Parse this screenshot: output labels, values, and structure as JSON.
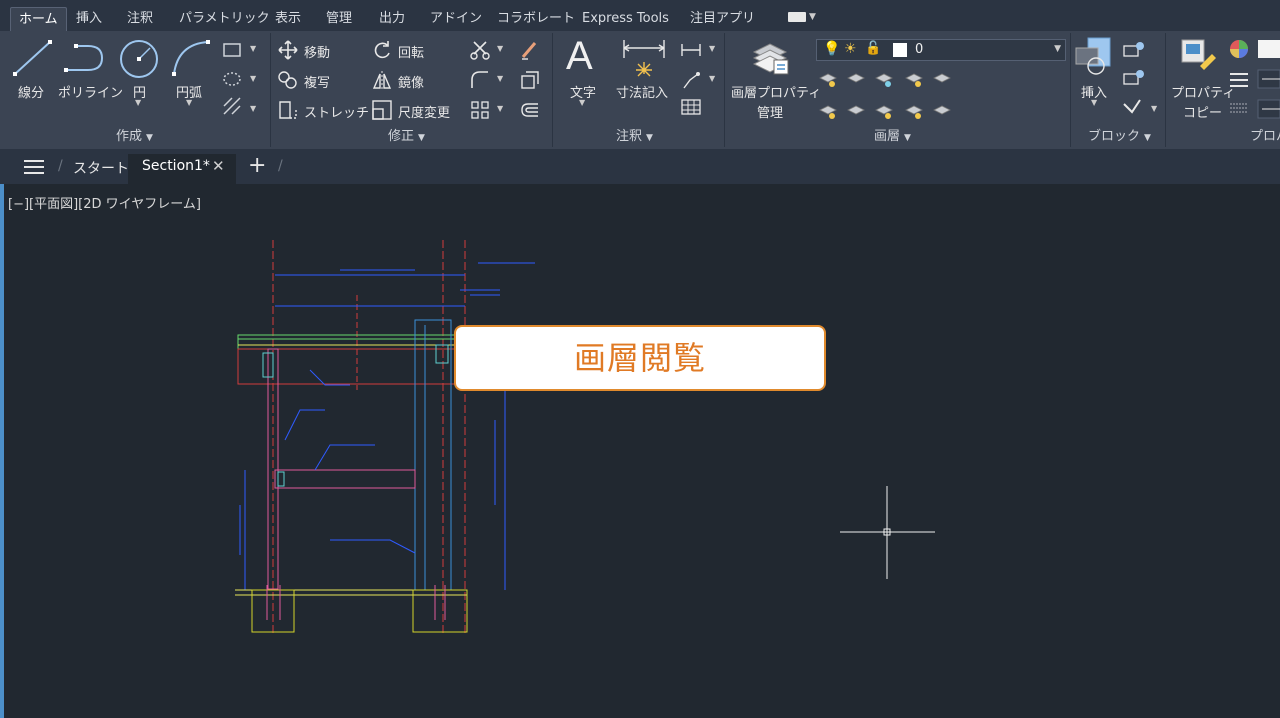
{
  "menu_tabs": [
    "ホーム",
    "挿入",
    "注釈",
    "パラメトリック",
    "表示",
    "管理",
    "出力",
    "アドイン",
    "コラボレート",
    "Express Tools",
    "注目アプリ"
  ],
  "draw_panel": {
    "title": "作成",
    "line": "線分",
    "polyline": "ポリライン",
    "circle": "円",
    "arc": "円弧"
  },
  "modify_panel": {
    "title": "修正",
    "move": "移動",
    "copy": "複写",
    "stretch": "ストレッチ",
    "rotate": "回転",
    "mirror": "鏡像",
    "scale": "尺度変更"
  },
  "annotation_panel": {
    "title": "注釈",
    "text": "文字",
    "dimension": "寸法記入"
  },
  "layers_panel": {
    "title": "画層",
    "properties_line1": "画層プロパティ",
    "properties_line2": "管理",
    "current_layer": "0"
  },
  "block_panel": {
    "title": "ブロック",
    "insert": "挿入"
  },
  "properties_panel": {
    "title": "プロパ",
    "match_line1": "プロパティ",
    "match_line2": "コピー"
  },
  "file_tabs": {
    "start": "スタート",
    "active": "Section1*"
  },
  "viewport_label": "[−][平面図][2D ワイヤフレーム]",
  "tooltip": "画層閲覧",
  "colors": {
    "accent": "#e08a2d",
    "canvas": "#212830",
    "ribbon": "#3b4453",
    "active_border": "#4c8fc9"
  }
}
